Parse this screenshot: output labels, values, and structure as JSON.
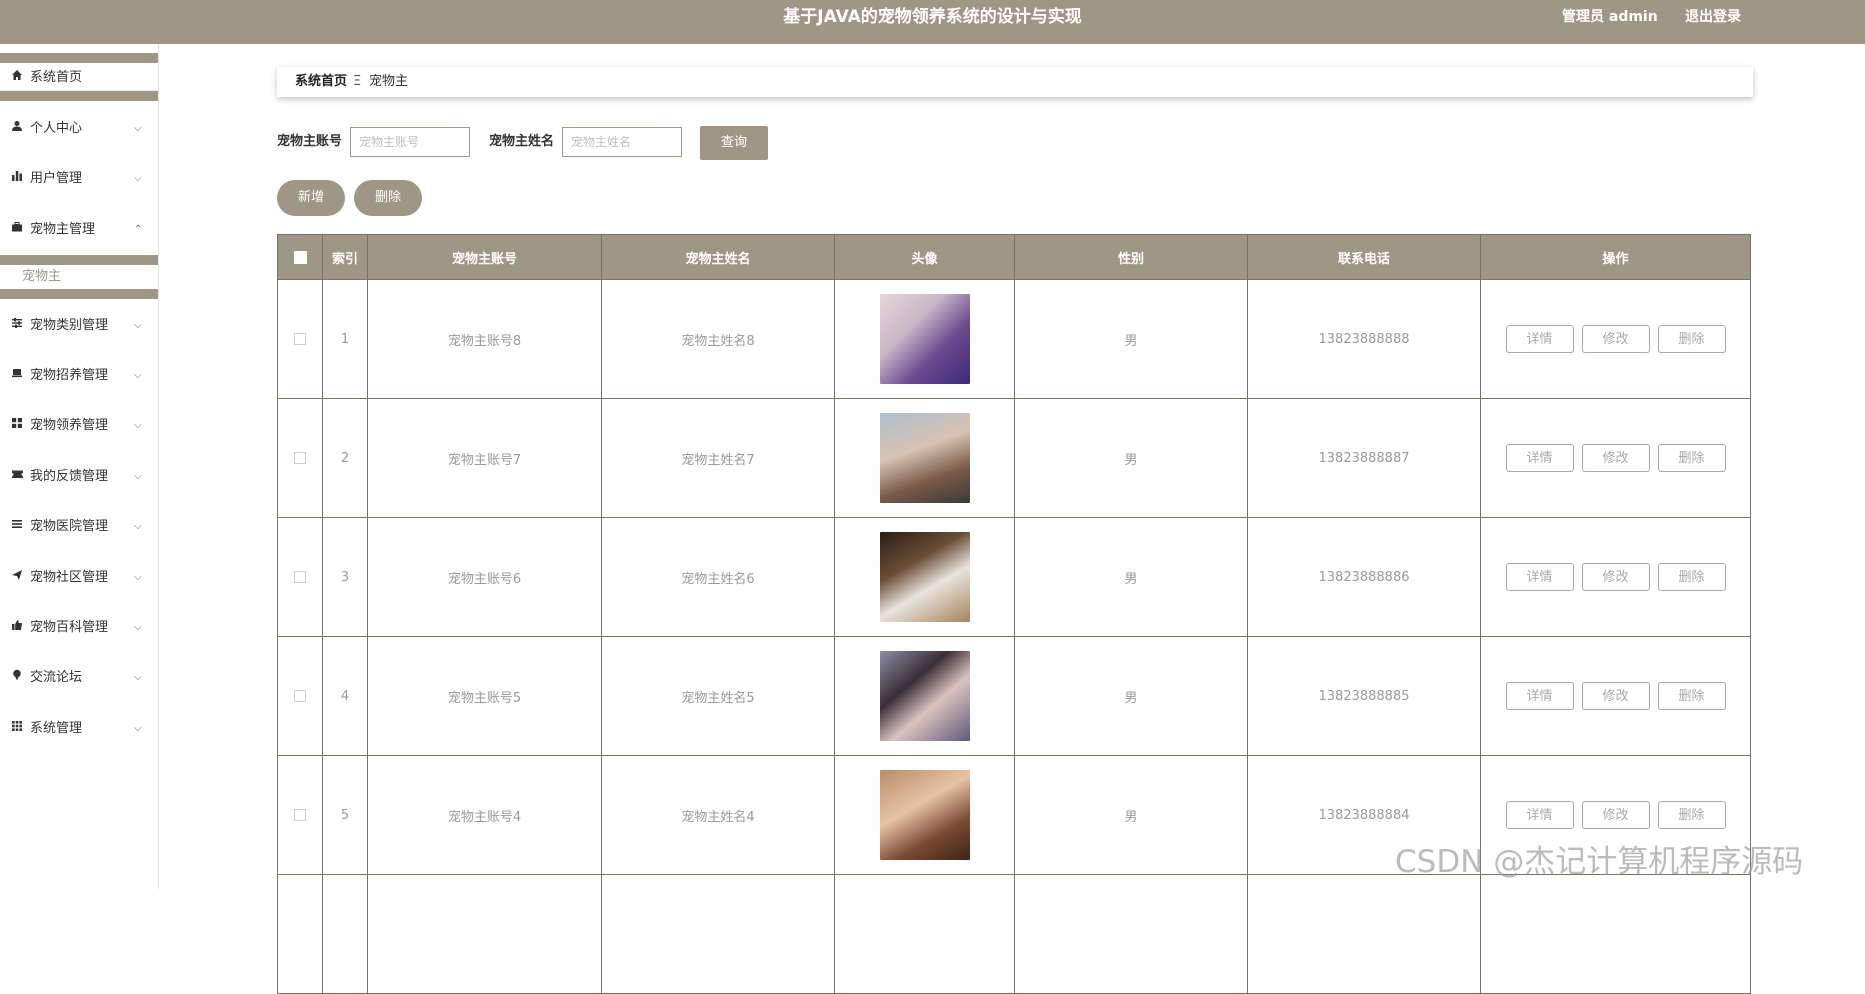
{
  "header": {
    "title": "基于JAVA的宠物领养系统的设计与实现",
    "user": "管理员 admin",
    "logout": "退出登录"
  },
  "sidebar": {
    "home": "系统首页",
    "items": [
      {
        "label": "个人中心",
        "icon": "user-icon"
      },
      {
        "label": "用户管理",
        "icon": "bar-chart-icon"
      },
      {
        "label": "宠物主管理",
        "icon": "briefcase-icon"
      },
      {
        "label": "宠物类别管理",
        "icon": "sliders-icon"
      },
      {
        "label": "宠物招养管理",
        "icon": "laptop-icon"
      },
      {
        "label": "宠物领养管理",
        "icon": "grid-icon"
      },
      {
        "label": "我的反馈管理",
        "icon": "ticket-icon"
      },
      {
        "label": "宠物医院管理",
        "icon": "list-icon"
      },
      {
        "label": "宠物社区管理",
        "icon": "send-icon"
      },
      {
        "label": "宠物百科管理",
        "icon": "thumbs-up-icon"
      },
      {
        "label": "交流论坛",
        "icon": "pin-icon"
      },
      {
        "label": "系统管理",
        "icon": "apps-icon"
      }
    ],
    "submenu": "宠物主"
  },
  "breadcrumb": {
    "home": "系统首页",
    "sep": "Ξ",
    "current": "宠物主"
  },
  "search": {
    "account_label": "宠物主账号",
    "account_placeholder": "宠物主账号",
    "name_label": "宠物主姓名",
    "name_placeholder": "宠物主姓名",
    "query": "查询"
  },
  "actions": {
    "add": "新增",
    "delete": "删除"
  },
  "table": {
    "headers": [
      "索引",
      "宠物主账号",
      "宠物主姓名",
      "头像",
      "性别",
      "联系电话",
      "操作"
    ],
    "op_labels": {
      "detail": "详情",
      "edit": "修改",
      "delete": "删除"
    },
    "rows": [
      {
        "index": "1",
        "account": "宠物主账号8",
        "name": "宠物主姓名8",
        "gender": "男",
        "phone": "13823888888"
      },
      {
        "index": "2",
        "account": "宠物主账号7",
        "name": "宠物主姓名7",
        "gender": "男",
        "phone": "13823888887"
      },
      {
        "index": "3",
        "account": "宠物主账号6",
        "name": "宠物主姓名6",
        "gender": "男",
        "phone": "13823888886"
      },
      {
        "index": "4",
        "account": "宠物主账号5",
        "name": "宠物主姓名5",
        "gender": "男",
        "phone": "13823888885"
      },
      {
        "index": "5",
        "account": "宠物主账号4",
        "name": "宠物主姓名4",
        "gender": "男",
        "phone": "13823888884"
      }
    ]
  },
  "watermark": "CSDN @杰记计算机程序源码",
  "colors": {
    "accent": "#a09686"
  }
}
